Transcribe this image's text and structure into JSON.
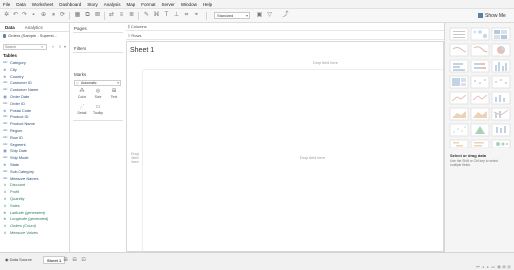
{
  "menubar": [
    "File",
    "Data",
    "Worksheet",
    "Dashboard",
    "Story",
    "Analysis",
    "Map",
    "Format",
    "Server",
    "Window",
    "Help"
  ],
  "toolbar": {
    "fit_value": "Standard",
    "show_me_label": "Show Me"
  },
  "data_pane": {
    "tab_data": "Data",
    "tab_analytics": "Analytics",
    "datasource": "Orders (Sample - Superst...",
    "search_placeholder": "Search",
    "tables_heading": "Tables",
    "fields": [
      {
        "name": "Category",
        "kind": "dim",
        "icon": "Abc"
      },
      {
        "name": "City",
        "kind": "dim",
        "icon": "globe"
      },
      {
        "name": "Country",
        "kind": "dim",
        "icon": "globe"
      },
      {
        "name": "Customer ID",
        "kind": "dim",
        "icon": "Abc"
      },
      {
        "name": "Customer Name",
        "kind": "dim",
        "icon": "Abc"
      },
      {
        "name": "Order Date",
        "kind": "dim",
        "icon": "date"
      },
      {
        "name": "Order ID",
        "kind": "dim",
        "icon": "Abc"
      },
      {
        "name": "Postal Code",
        "kind": "dim",
        "icon": "globe"
      },
      {
        "name": "Product ID",
        "kind": "dim",
        "icon": "Abc"
      },
      {
        "name": "Product Name",
        "kind": "dim",
        "icon": "Abc"
      },
      {
        "name": "Region",
        "kind": "dim",
        "icon": "Abc"
      },
      {
        "name": "Row ID",
        "kind": "dim",
        "icon": "Abc"
      },
      {
        "name": "Segment",
        "kind": "dim",
        "icon": "Abc"
      },
      {
        "name": "Ship Date",
        "kind": "dim",
        "icon": "date"
      },
      {
        "name": "Ship Mode",
        "kind": "dim",
        "icon": "Abc"
      },
      {
        "name": "State",
        "kind": "dim",
        "icon": "globe"
      },
      {
        "name": "Sub-Category",
        "kind": "dim",
        "icon": "Abc"
      },
      {
        "name": "Measure Names",
        "kind": "dim",
        "icon": "Abc",
        "italic": true
      },
      {
        "name": "Discount",
        "kind": "meas",
        "icon": "#"
      },
      {
        "name": "Profit",
        "kind": "meas",
        "icon": "#"
      },
      {
        "name": "Quantity",
        "kind": "meas",
        "icon": "#"
      },
      {
        "name": "Sales",
        "kind": "meas",
        "icon": "#"
      },
      {
        "name": "Latitude (generated)",
        "kind": "meas",
        "icon": "globe",
        "italic": true
      },
      {
        "name": "Longitude (generated)",
        "kind": "meas",
        "icon": "globe",
        "italic": true
      },
      {
        "name": "Orders (Count)",
        "kind": "meas",
        "icon": "#",
        "italic": true
      },
      {
        "name": "Measure Values",
        "kind": "meas",
        "icon": "#",
        "italic": true
      }
    ]
  },
  "cards": {
    "pages": "Pages",
    "filters": "Filters",
    "marks": "Marks",
    "marks_type": "Automatic",
    "buttons": [
      "Color",
      "Size",
      "Text",
      "Detail",
      "Tooltip"
    ]
  },
  "shelves": {
    "columns": "Columns",
    "rows": "Rows"
  },
  "view": {
    "sheet_title": "Sheet 1",
    "drop_field_top": "Drop field here",
    "drop_field_center": "Drop field here",
    "drop_field_left": "Drop field here"
  },
  "show_me": {
    "heading": "Select or drag data",
    "subtext": "Use the Shift or Ctrl key to select multiple fields"
  },
  "status": {
    "data_source_tab": "Data Source",
    "sheet_tab": "Sheet 1"
  },
  "colors": {
    "dimension": "#4a78b0",
    "measure": "#2f9e74",
    "accent": "#5b7fa8"
  }
}
